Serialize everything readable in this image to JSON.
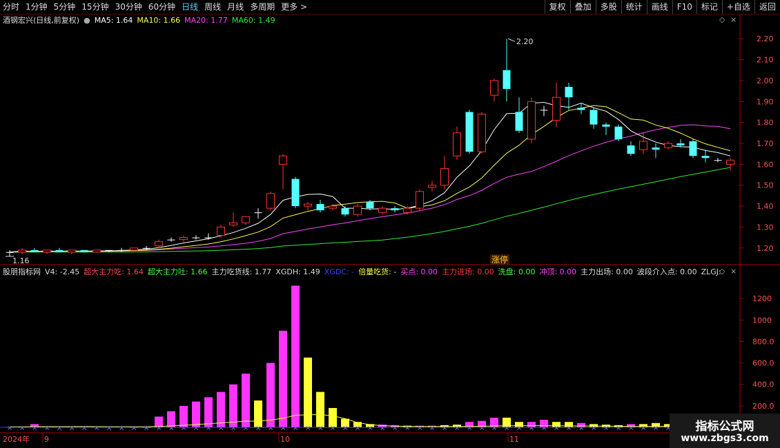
{
  "toolbar": {
    "periods": [
      "分时",
      "1分钟",
      "5分钟",
      "15分钟",
      "30分钟",
      "60分钟",
      "日线",
      "周线",
      "月线",
      "多周期",
      "更多 >"
    ],
    "active_index": 6,
    "right_buttons": [
      "复权",
      "叠加",
      "多股",
      "统计",
      "画线",
      "F10",
      "标记",
      "+自选",
      "返回"
    ]
  },
  "colors": {
    "up": "#ff3232",
    "down": "#54ffff",
    "ma5": "#ffffff",
    "ma10": "#ffff55",
    "ma20": "#ff44ff",
    "ma60": "#33ee33",
    "axis": "#b00000",
    "grid": "#3a0000",
    "tick": "#ff5050",
    "magenta": "#ff33ff",
    "yellow": "#ffff33",
    "cyan": "#8080ff"
  },
  "legend_top": {
    "stock": "酒钢宏兴(日线,前复权)",
    "ma5_label": "MA5: 1.64",
    "ma10_label": "MA10: 1.66",
    "ma20_label": "MA20: 1.77",
    "ma60_label": "MA60: 1.49"
  },
  "legend_bottom": [
    {
      "text": "股朋指标网",
      "color": "#dddddd"
    },
    {
      "text": "V4: -2.45",
      "color": "#dddddd"
    },
    {
      "text": "超大主力吃: 1.64",
      "color": "#ff4455"
    },
    {
      "text": "超大主力吐: 1.66",
      "color": "#44ff44"
    },
    {
      "text": "主力吃货线: 1.77",
      "color": "#dddddd"
    },
    {
      "text": "XGDH: 1.49",
      "color": "#dddddd"
    },
    {
      "text": "XGDC: -",
      "color": "#3344ff"
    },
    {
      "text": "倍量吃货: -",
      "color": "#ffff44"
    },
    {
      "text": "买点: 0.00",
      "color": "#ff44ff"
    },
    {
      "text": "主力进场: 0.00",
      "color": "#ff3333"
    },
    {
      "text": "洗盘: 0.00",
      "color": "#44ff44"
    },
    {
      "text": "冲顶: 0.00",
      "color": "#ff44ff"
    },
    {
      "text": "主力出场: 0.00",
      "color": "#dddddd"
    },
    {
      "text": "波段介入点: 0.00",
      "color": "#dddddd"
    },
    {
      "text": "ZLGJ:",
      "color": "#dddddd"
    }
  ],
  "annotations": {
    "high_label": "2.20",
    "low_label": "1.16",
    "limit_up": "涨停"
  },
  "watermark": {
    "line1": "指标公式网",
    "line2": "www.zbgs3.com"
  },
  "chart_data": [
    {
      "type": "candlestick",
      "ylim": [
        1.14,
        2.26
      ],
      "y_ticks": [
        1.2,
        1.3,
        1.4,
        1.5,
        1.6,
        1.7,
        1.8,
        1.9,
        2.0,
        2.1,
        2.2
      ],
      "candles": [
        {
          "o": 1.18,
          "h": 1.19,
          "l": 1.16,
          "c": 1.18
        },
        {
          "o": 1.18,
          "h": 1.2,
          "l": 1.17,
          "c": 1.19
        },
        {
          "o": 1.19,
          "h": 1.2,
          "l": 1.18,
          "c": 1.18
        },
        {
          "o": 1.18,
          "h": 1.19,
          "l": 1.17,
          "c": 1.19
        },
        {
          "o": 1.19,
          "h": 1.2,
          "l": 1.18,
          "c": 1.18
        },
        {
          "o": 1.18,
          "h": 1.19,
          "l": 1.17,
          "c": 1.19
        },
        {
          "o": 1.19,
          "h": 1.19,
          "l": 1.18,
          "c": 1.18
        },
        {
          "o": 1.18,
          "h": 1.19,
          "l": 1.18,
          "c": 1.19
        },
        {
          "o": 1.19,
          "h": 1.19,
          "l": 1.18,
          "c": 1.19
        },
        {
          "o": 1.19,
          "h": 1.2,
          "l": 1.18,
          "c": 1.19
        },
        {
          "o": 1.19,
          "h": 1.2,
          "l": 1.18,
          "c": 1.2
        },
        {
          "o": 1.2,
          "h": 1.21,
          "l": 1.19,
          "c": 1.2
        },
        {
          "o": 1.21,
          "h": 1.24,
          "l": 1.2,
          "c": 1.23
        },
        {
          "o": 1.24,
          "h": 1.25,
          "l": 1.23,
          "c": 1.24
        },
        {
          "o": 1.24,
          "h": 1.26,
          "l": 1.23,
          "c": 1.25
        },
        {
          "o": 1.25,
          "h": 1.26,
          "l": 1.24,
          "c": 1.25
        },
        {
          "o": 1.25,
          "h": 1.27,
          "l": 1.24,
          "c": 1.25
        },
        {
          "o": 1.26,
          "h": 1.31,
          "l": 1.25,
          "c": 1.3
        },
        {
          "o": 1.31,
          "h": 1.37,
          "l": 1.3,
          "c": 1.32
        },
        {
          "o": 1.32,
          "h": 1.35,
          "l": 1.31,
          "c": 1.35
        },
        {
          "o": 1.37,
          "h": 1.39,
          "l": 1.34,
          "c": 1.37
        },
        {
          "o": 1.39,
          "h": 1.47,
          "l": 1.38,
          "c": 1.46
        },
        {
          "o": 1.6,
          "h": 1.65,
          "l": 1.48,
          "c": 1.64
        },
        {
          "o": 1.53,
          "h": 1.54,
          "l": 1.39,
          "c": 1.4
        },
        {
          "o": 1.4,
          "h": 1.42,
          "l": 1.38,
          "c": 1.41
        },
        {
          "o": 1.41,
          "h": 1.43,
          "l": 1.37,
          "c": 1.38
        },
        {
          "o": 1.39,
          "h": 1.41,
          "l": 1.38,
          "c": 1.4
        },
        {
          "o": 1.39,
          "h": 1.4,
          "l": 1.35,
          "c": 1.36
        },
        {
          "o": 1.36,
          "h": 1.41,
          "l": 1.35,
          "c": 1.4
        },
        {
          "o": 1.42,
          "h": 1.43,
          "l": 1.38,
          "c": 1.39
        },
        {
          "o": 1.37,
          "h": 1.4,
          "l": 1.36,
          "c": 1.39
        },
        {
          "o": 1.39,
          "h": 1.4,
          "l": 1.37,
          "c": 1.38
        },
        {
          "o": 1.37,
          "h": 1.4,
          "l": 1.36,
          "c": 1.39
        },
        {
          "o": 1.39,
          "h": 1.48,
          "l": 1.38,
          "c": 1.47
        },
        {
          "o": 1.49,
          "h": 1.52,
          "l": 1.47,
          "c": 1.5
        },
        {
          "o": 1.5,
          "h": 1.64,
          "l": 1.48,
          "c": 1.58
        },
        {
          "o": 1.64,
          "h": 1.78,
          "l": 1.62,
          "c": 1.75
        },
        {
          "o": 1.85,
          "h": 1.86,
          "l": 1.65,
          "c": 1.66
        },
        {
          "o": 1.66,
          "h": 1.85,
          "l": 1.65,
          "c": 1.84
        },
        {
          "o": 1.93,
          "h": 2.01,
          "l": 1.9,
          "c": 2.0
        },
        {
          "o": 2.05,
          "h": 2.2,
          "l": 1.9,
          "c": 1.96
        },
        {
          "o": 1.85,
          "h": 1.92,
          "l": 1.75,
          "c": 1.76
        },
        {
          "o": 1.72,
          "h": 1.92,
          "l": 1.7,
          "c": 1.9
        },
        {
          "o": 1.86,
          "h": 1.88,
          "l": 1.83,
          "c": 1.86
        },
        {
          "o": 1.81,
          "h": 1.99,
          "l": 1.78,
          "c": 1.92
        },
        {
          "o": 1.97,
          "h": 1.99,
          "l": 1.86,
          "c": 1.92
        },
        {
          "o": 1.87,
          "h": 1.89,
          "l": 1.84,
          "c": 1.86
        },
        {
          "o": 1.86,
          "h": 1.87,
          "l": 1.77,
          "c": 1.79
        },
        {
          "o": 1.79,
          "h": 1.8,
          "l": 1.74,
          "c": 1.78
        },
        {
          "o": 1.78,
          "h": 1.79,
          "l": 1.71,
          "c": 1.72
        },
        {
          "o": 1.69,
          "h": 1.71,
          "l": 1.64,
          "c": 1.65
        },
        {
          "o": 1.67,
          "h": 1.75,
          "l": 1.65,
          "c": 1.71
        },
        {
          "o": 1.68,
          "h": 1.7,
          "l": 1.63,
          "c": 1.67
        },
        {
          "o": 1.68,
          "h": 1.71,
          "l": 1.67,
          "c": 1.7
        },
        {
          "o": 1.7,
          "h": 1.72,
          "l": 1.68,
          "c": 1.69
        },
        {
          "o": 1.71,
          "h": 1.72,
          "l": 1.63,
          "c": 1.64
        },
        {
          "o": 1.64,
          "h": 1.67,
          "l": 1.61,
          "c": 1.63
        },
        {
          "o": 1.62,
          "h": 1.63,
          "l": 1.61,
          "c": 1.62
        },
        {
          "o": 1.6,
          "h": 1.63,
          "l": 1.57,
          "c": 1.62
        }
      ]
    },
    {
      "type": "bar",
      "ylim": [
        0,
        1400
      ],
      "y_ticks": [
        200.0,
        400.0,
        600.0,
        800.0,
        1000,
        1200
      ],
      "values": [
        2,
        2,
        30,
        10,
        5,
        10,
        10,
        5,
        5,
        5,
        2,
        2,
        100,
        150,
        200,
        240,
        280,
        330,
        400,
        500,
        250,
        600,
        900,
        1320,
        650,
        330,
        180,
        80,
        50,
        30,
        25,
        20,
        15,
        15,
        15,
        20,
        25,
        50,
        60,
        90,
        90,
        50,
        50,
        70,
        50,
        50,
        40,
        30,
        25,
        20,
        30,
        30,
        40,
        30,
        30,
        30,
        80,
        90,
        70
      ],
      "color_groups": [
        "magenta",
        "magenta",
        "magenta",
        "yellow",
        "yellow",
        "magenta",
        "magenta",
        "yellow",
        "yellow",
        "magenta",
        "yellow",
        "yellow",
        "magenta",
        "magenta",
        "magenta",
        "magenta",
        "magenta",
        "magenta",
        "magenta",
        "magenta",
        "yellow",
        "magenta",
        "magenta",
        "magenta",
        "yellow",
        "yellow",
        "yellow",
        "yellow",
        "yellow",
        "yellow",
        "magenta",
        "magenta",
        "yellow",
        "magenta",
        "magenta",
        "yellow",
        "yellow",
        "magenta",
        "magenta",
        "magenta",
        "yellow",
        "yellow",
        "magenta",
        "magenta",
        "yellow",
        "yellow",
        "magenta",
        "yellow",
        "yellow",
        "yellow",
        "magenta",
        "yellow",
        "yellow",
        "yellow",
        "magenta",
        "magenta",
        "yellow",
        "yellow",
        "magenta"
      ],
      "x_labels": [
        "2024年",
        "9",
        "10",
        "11"
      ]
    }
  ]
}
